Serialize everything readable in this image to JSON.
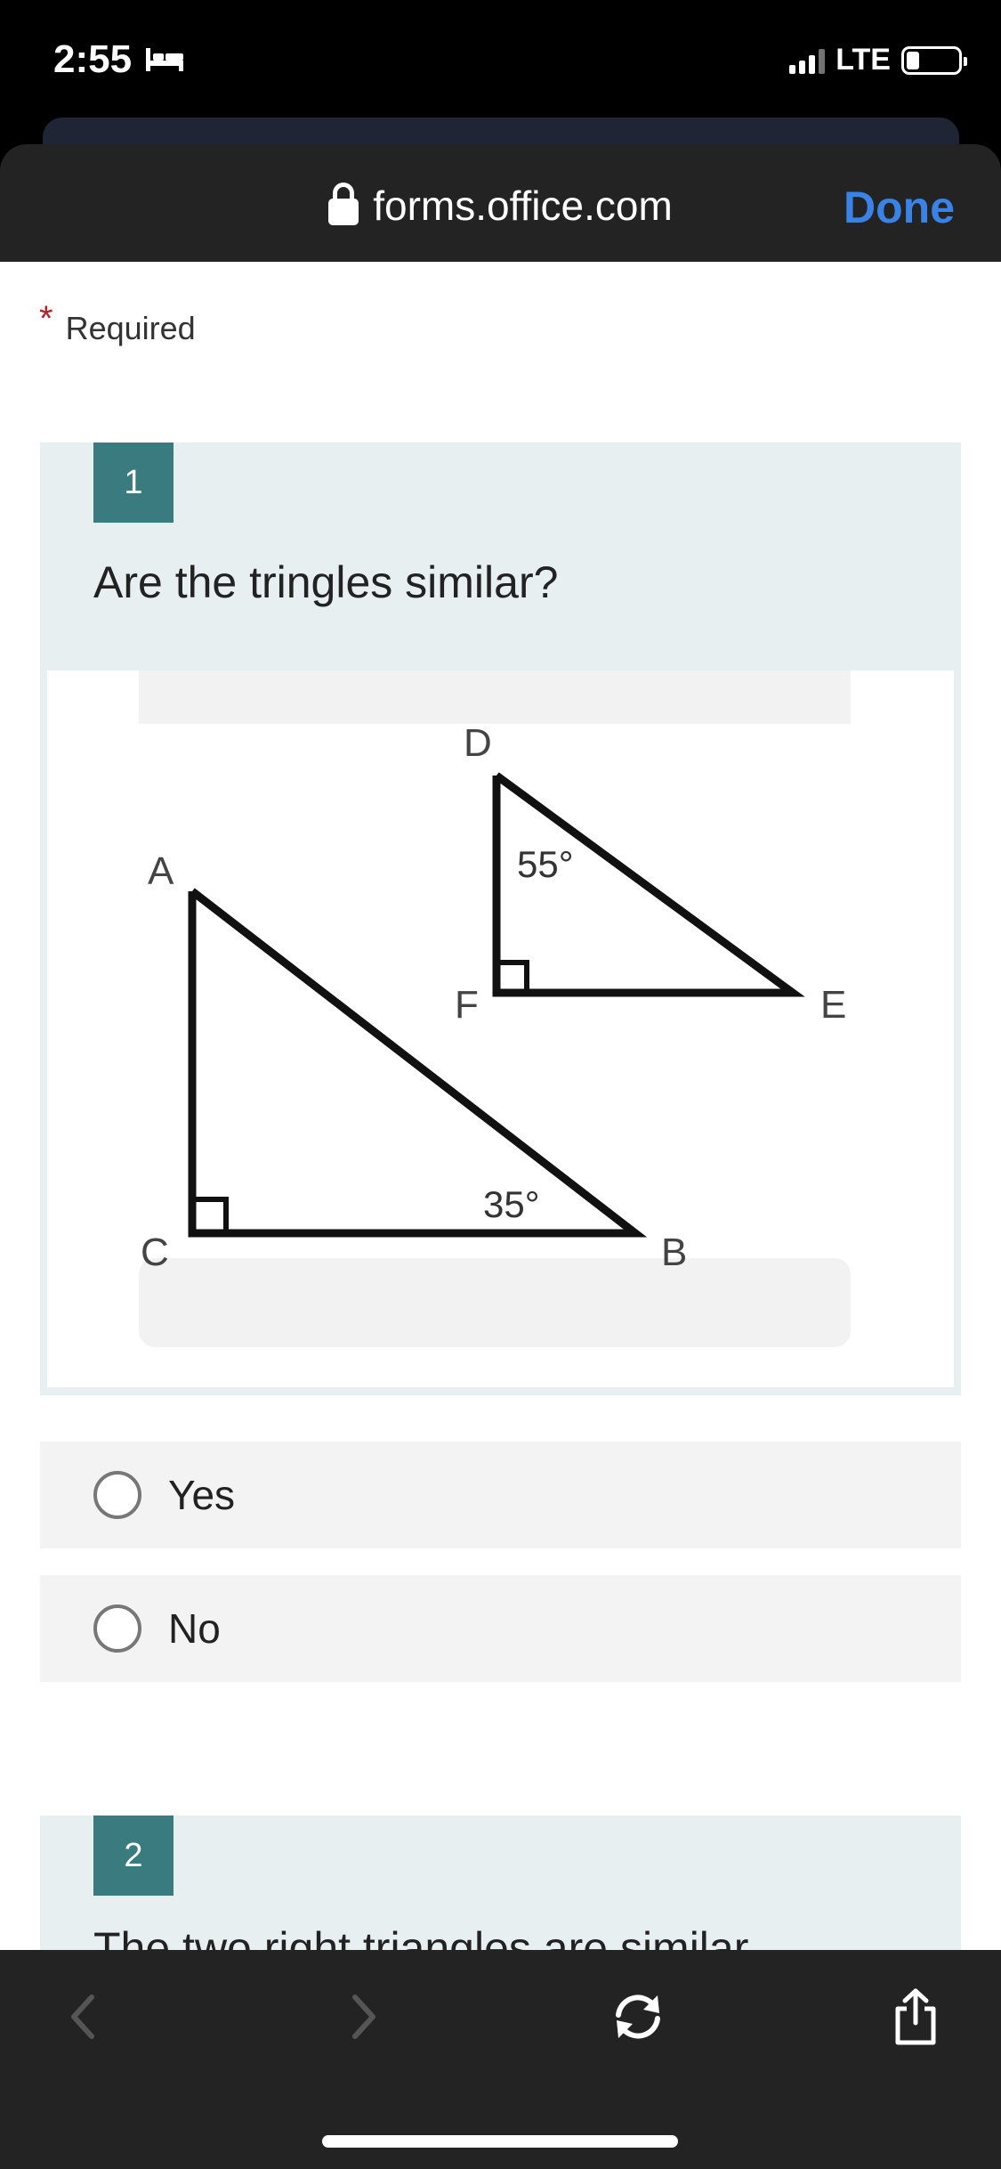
{
  "status_bar": {
    "time": "2:55",
    "network": "LTE"
  },
  "browser": {
    "url": "forms.office.com",
    "done_label": "Done"
  },
  "form": {
    "required_label": "Required",
    "questions": [
      {
        "number": "1",
        "title": "Are the tringles similar?",
        "figure_labels": {
          "A": "A",
          "B": "B",
          "C": "C",
          "D": "D",
          "E": "E",
          "F": "F",
          "angle_top": "55°",
          "angle_bottom": "35°"
        },
        "options": [
          "Yes",
          "No"
        ]
      },
      {
        "number": "2",
        "title": "The two right triangles are similar"
      }
    ]
  },
  "toolbar": {
    "icons": [
      "back-icon",
      "forward-icon",
      "refresh-icon",
      "share-icon"
    ]
  },
  "colors": {
    "accent_teal": "#397b7f",
    "link_blue": "#3b82e6",
    "required_red": "#b0232d"
  }
}
